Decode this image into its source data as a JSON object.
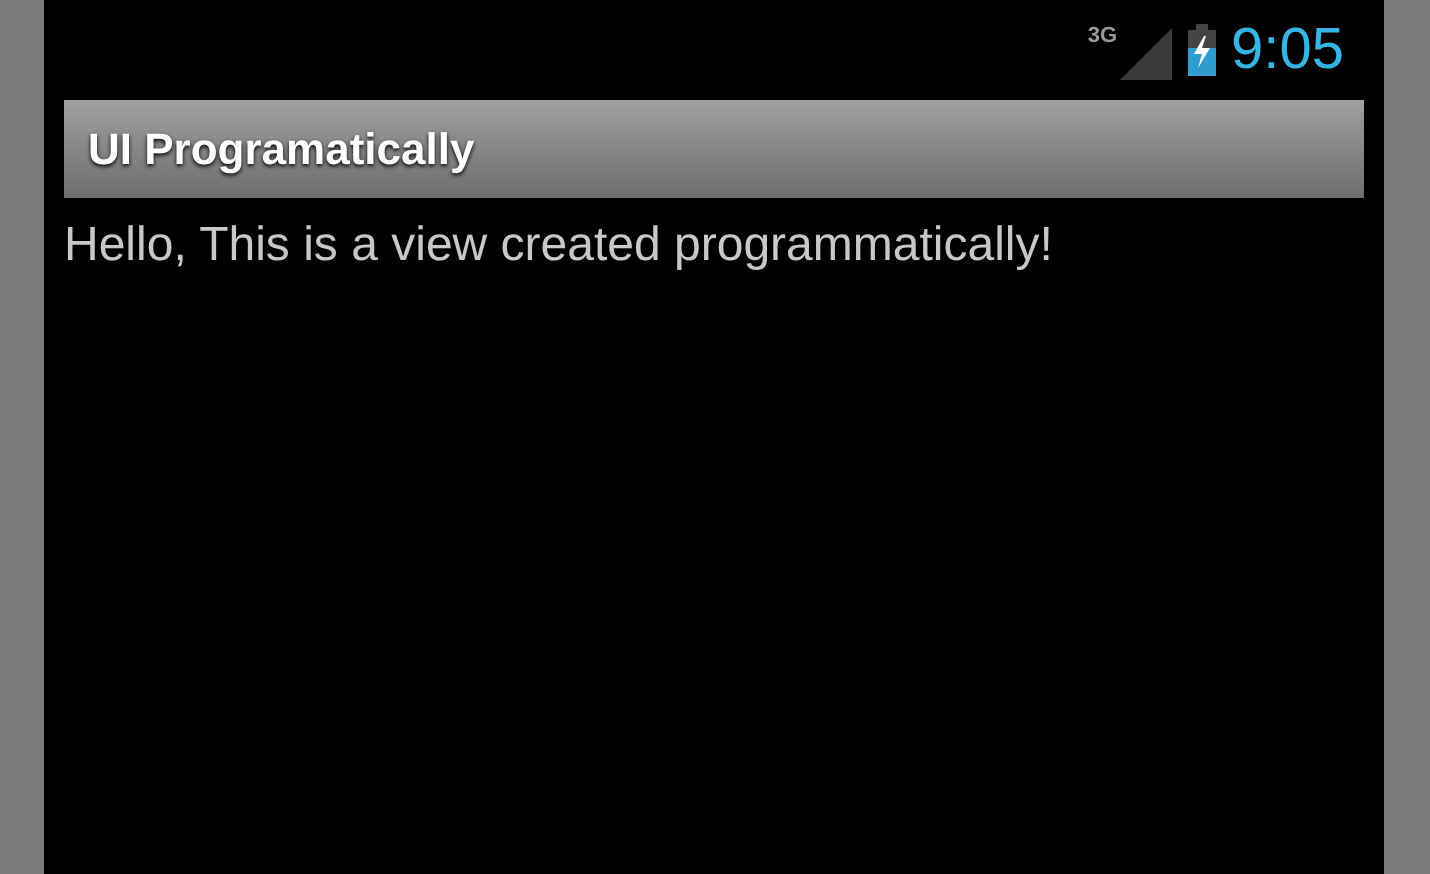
{
  "status_bar": {
    "network": "3G",
    "time": "9:05"
  },
  "action_bar": {
    "title": "UI Programatically"
  },
  "content": {
    "text": "Hello, This is a view created programmatically!"
  }
}
